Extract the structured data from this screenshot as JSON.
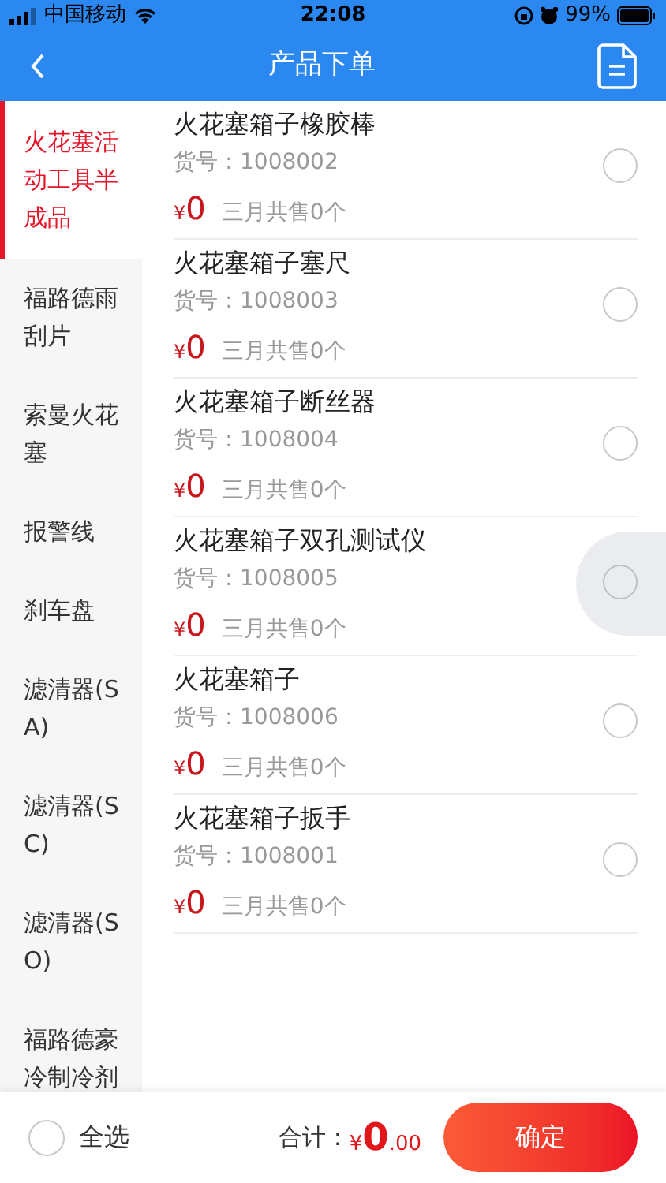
{
  "status_bar": {
    "carrier": "中国移动",
    "time": "22:08",
    "battery": "99%"
  },
  "nav": {
    "title": "产品下单"
  },
  "categories": [
    {
      "label": "火花塞活动工具半成品",
      "selected": true
    },
    {
      "label": "福路德雨刮片",
      "selected": false
    },
    {
      "label": "索曼火花塞",
      "selected": false
    },
    {
      "label": "报警线",
      "selected": false
    },
    {
      "label": "刹车盘",
      "selected": false
    },
    {
      "label": "滤清器(SA)",
      "selected": false
    },
    {
      "label": "滤清器(SC)",
      "selected": false
    },
    {
      "label": "滤清器(SO)",
      "selected": false
    },
    {
      "label": "福路德豪冷制冷剂",
      "selected": false
    }
  ],
  "products": [
    {
      "name": "火花塞箱子橡胶棒",
      "code": "货号：1008002",
      "currency": "¥",
      "price": "0",
      "sales": "三月共售0个",
      "checked": false
    },
    {
      "name": "火花塞箱子塞尺",
      "code": "货号：1008003",
      "currency": "¥",
      "price": "0",
      "sales": "三月共售0个",
      "checked": false
    },
    {
      "name": "火花塞箱子断丝器",
      "code": "货号：1008004",
      "currency": "¥",
      "price": "0",
      "sales": "三月共售0个",
      "checked": false
    },
    {
      "name": "火花塞箱子双孔测试仪",
      "code": "货号：1008005",
      "currency": "¥",
      "price": "0",
      "sales": "三月共售0个",
      "checked": false
    },
    {
      "name": "火花塞箱子",
      "code": "货号：1008006",
      "currency": "¥",
      "price": "0",
      "sales": "三月共售0个",
      "checked": false
    },
    {
      "name": "火花塞箱子扳手",
      "code": "货号：1008001",
      "currency": "¥",
      "price": "0",
      "sales": "三月共售0个",
      "checked": false
    }
  ],
  "footer": {
    "select_all": {
      "label": "全选",
      "checked": false
    },
    "total_label": "合计：",
    "currency": "¥",
    "total_integer": "0",
    "total_decimal": ".00",
    "confirm": "确定"
  }
}
